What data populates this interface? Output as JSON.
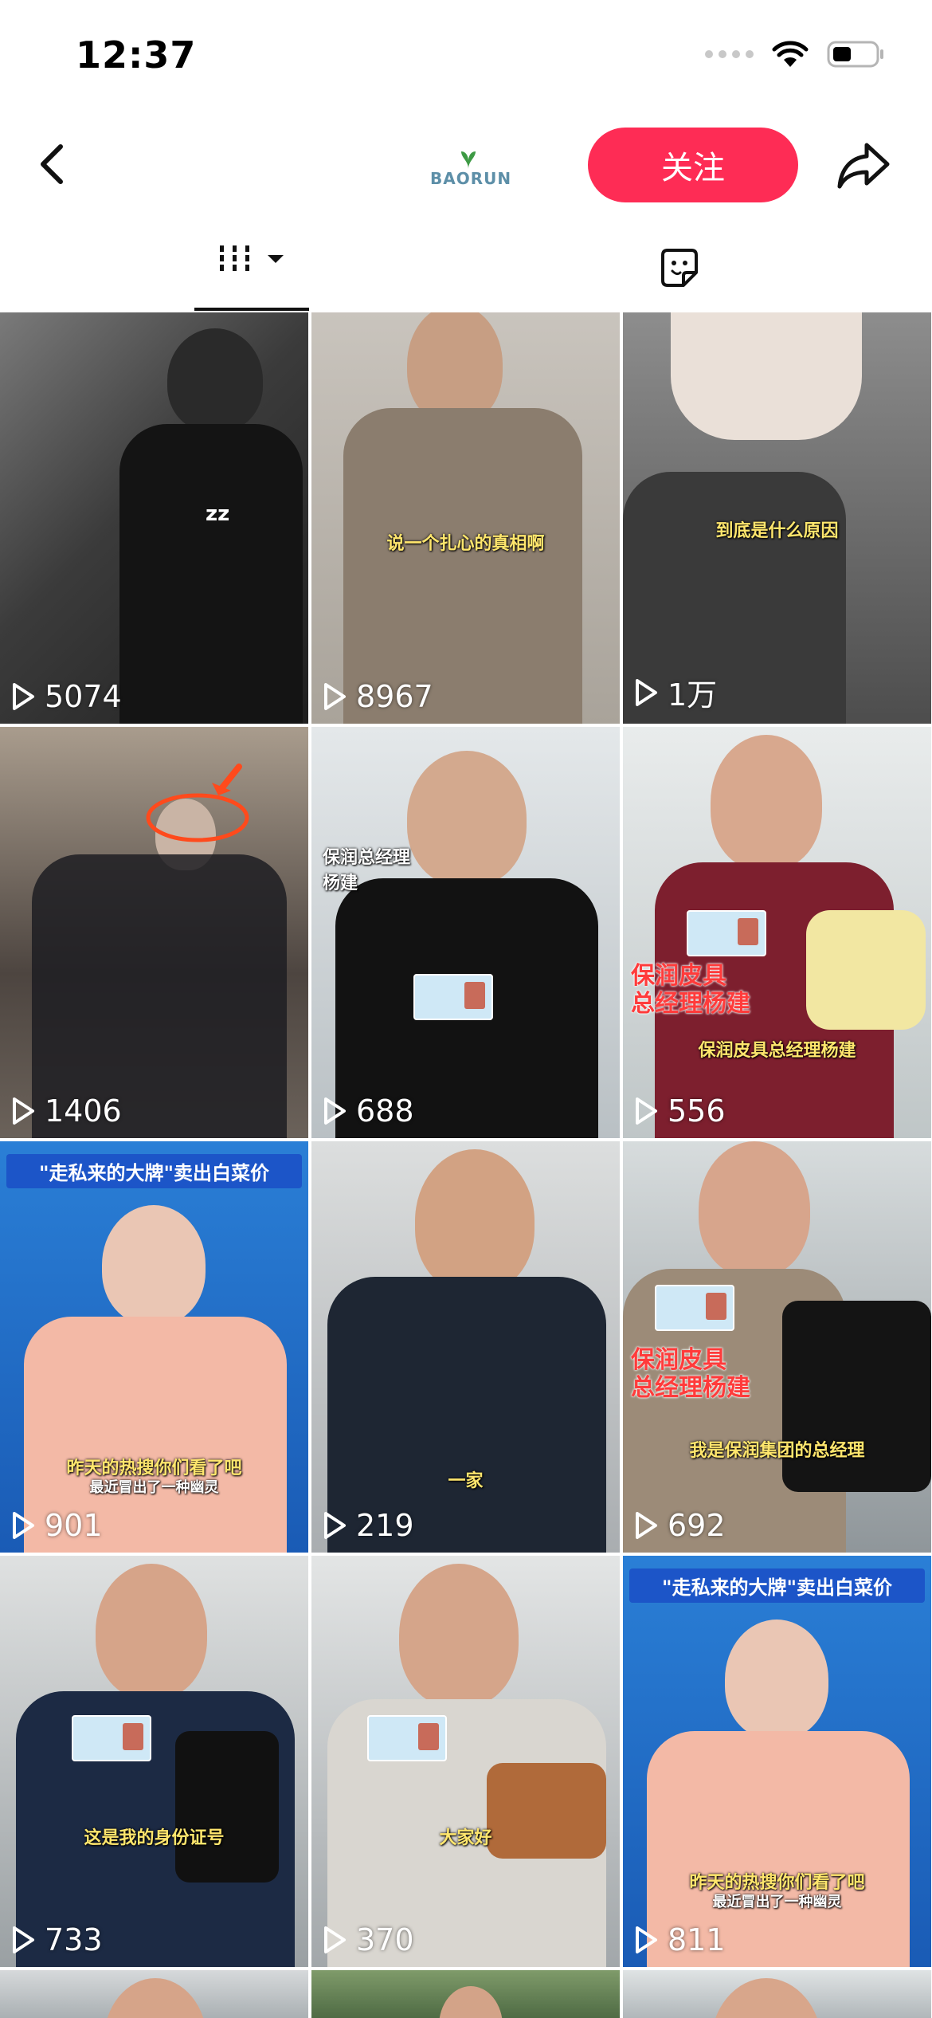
{
  "status_bar": {
    "time": "12:37"
  },
  "header": {
    "brand": "BAORUN",
    "follow_label": "关注"
  },
  "tiles": [
    {
      "plays": "5074",
      "caption": "",
      "overlay": "zz"
    },
    {
      "plays": "8967",
      "caption": "说一个扎心的真相啊"
    },
    {
      "plays": "1万",
      "caption": "到底是什么原因"
    },
    {
      "plays": "1406",
      "caption": ""
    },
    {
      "plays": "688",
      "caption": "",
      "label": "保润总经理\n杨建"
    },
    {
      "plays": "556",
      "caption": "保润皮具总经理杨建",
      "red_label": "保润皮具\n总经理杨建"
    },
    {
      "plays": "901",
      "headline": "\"走私来的大牌\"卖出白菜价",
      "caption": "昨天的热搜你们看了吧",
      "sub": "最近冒出了一种幽灵"
    },
    {
      "plays": "219",
      "caption": "一家"
    },
    {
      "plays": "692",
      "caption": "我是保润集团的总经理",
      "red_label": "保润皮具\n总经理杨建"
    },
    {
      "plays": "733",
      "caption": "这是我的身份证号"
    },
    {
      "plays": "370",
      "caption": "大家好"
    },
    {
      "plays": "811",
      "headline": "\"走私来的大牌\"卖出白菜价",
      "caption": "昨天的热搜你们看了吧",
      "sub": "最近冒出了一种幽灵"
    },
    {
      "plays": "",
      "caption": ""
    },
    {
      "plays": "",
      "caption": ""
    },
    {
      "plays": "",
      "caption": ""
    }
  ]
}
